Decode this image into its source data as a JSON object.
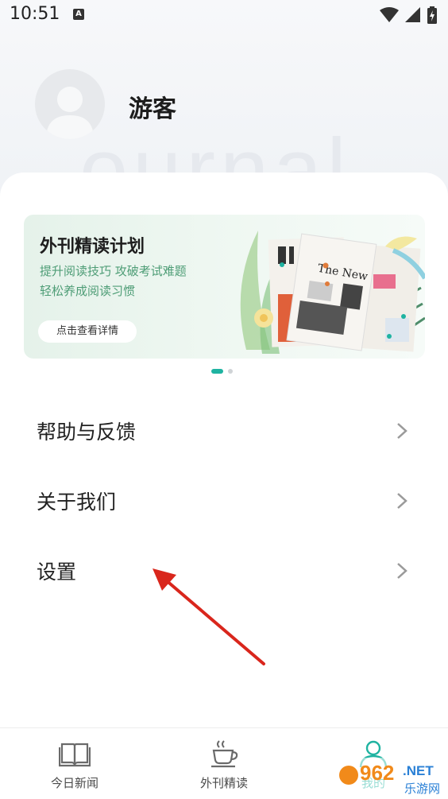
{
  "status_bar": {
    "time": "10:51",
    "notification_icon": "A"
  },
  "profile": {
    "username": "游客",
    "watermark_text": "ournal"
  },
  "banner": {
    "title": "外刊精读计划",
    "subtitle_line1": "提升阅读技巧  攻破考试难题",
    "subtitle_line2": "轻松养成阅读习惯",
    "button_label": "点击查看详情",
    "pager": {
      "count": 2,
      "active": 1
    }
  },
  "menu": [
    {
      "label": "帮助与反馈"
    },
    {
      "label": "关于我们"
    },
    {
      "label": "设置"
    }
  ],
  "bottom_nav": [
    {
      "label": "今日新闻",
      "icon": "book-icon"
    },
    {
      "label": "外刊精读",
      "icon": "coffee-cup-icon"
    },
    {
      "label": "我的",
      "icon": "person-icon",
      "active": true
    }
  ],
  "overlay_watermark": {
    "number": "962",
    "suffix": ".NET",
    "cn": "乐游网"
  },
  "colors": {
    "accent": "#1fb3a1",
    "banner_text": "#4e9d76",
    "annotation_arrow": "#d9261c"
  }
}
